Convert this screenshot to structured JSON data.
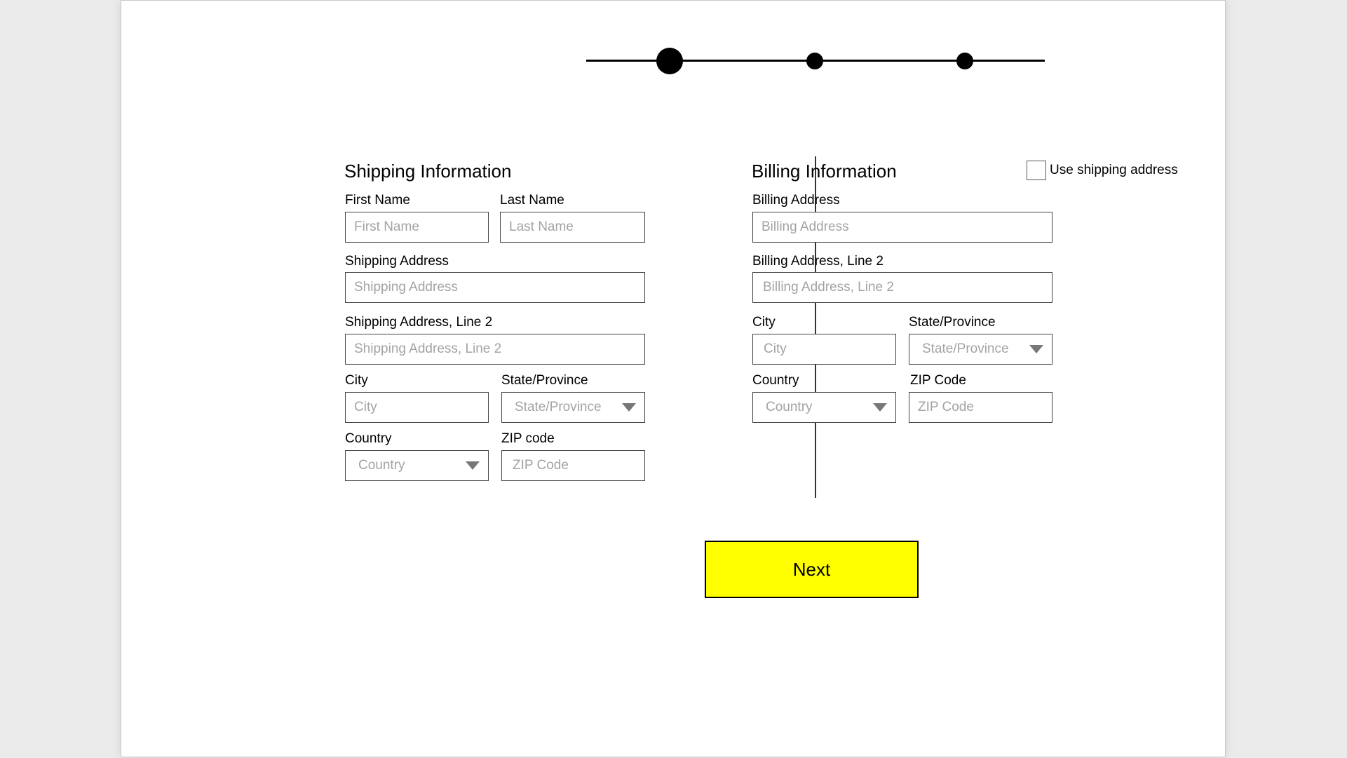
{
  "stepper": {
    "steps": 3,
    "active_step": 1
  },
  "shipping": {
    "title": "Shipping Information",
    "first_name": {
      "label": "First Name",
      "placeholder": "First Name"
    },
    "last_name": {
      "label": "Last Name",
      "placeholder": "Last Name"
    },
    "address": {
      "label": "Shipping Address",
      "placeholder": "Shipping Address"
    },
    "address2": {
      "label": "Shipping Address, Line 2",
      "placeholder": "Shipping Address, Line 2"
    },
    "city": {
      "label": "City",
      "placeholder": "City"
    },
    "state": {
      "label": "State/Province",
      "placeholder": "State/Province"
    },
    "country": {
      "label": "Country",
      "placeholder": "Country"
    },
    "zip": {
      "label": "ZIP code",
      "placeholder": "ZIP Code"
    }
  },
  "billing": {
    "title": "Billing Information",
    "use_shipping_label": "Use shipping address",
    "use_shipping_checked": false,
    "address": {
      "label": "Billing Address",
      "placeholder": "Billing Address"
    },
    "address2": {
      "label": "Billing Address, Line 2",
      "placeholder": "Billing Address, Line 2"
    },
    "city": {
      "label": "City",
      "placeholder": "City"
    },
    "state": {
      "label": "State/Province",
      "placeholder": "State/Province"
    },
    "country": {
      "label": "Country",
      "placeholder": "Country"
    },
    "zip": {
      "label": "ZIP Code",
      "placeholder": "ZIP Code"
    }
  },
  "actions": {
    "next_label": "Next"
  },
  "colors": {
    "next_button": "#ffff00",
    "placeholder_text": "#a3a3a3",
    "background": "#ebebeb"
  },
  "icons": {
    "dropdown": "chevron-down-icon"
  }
}
